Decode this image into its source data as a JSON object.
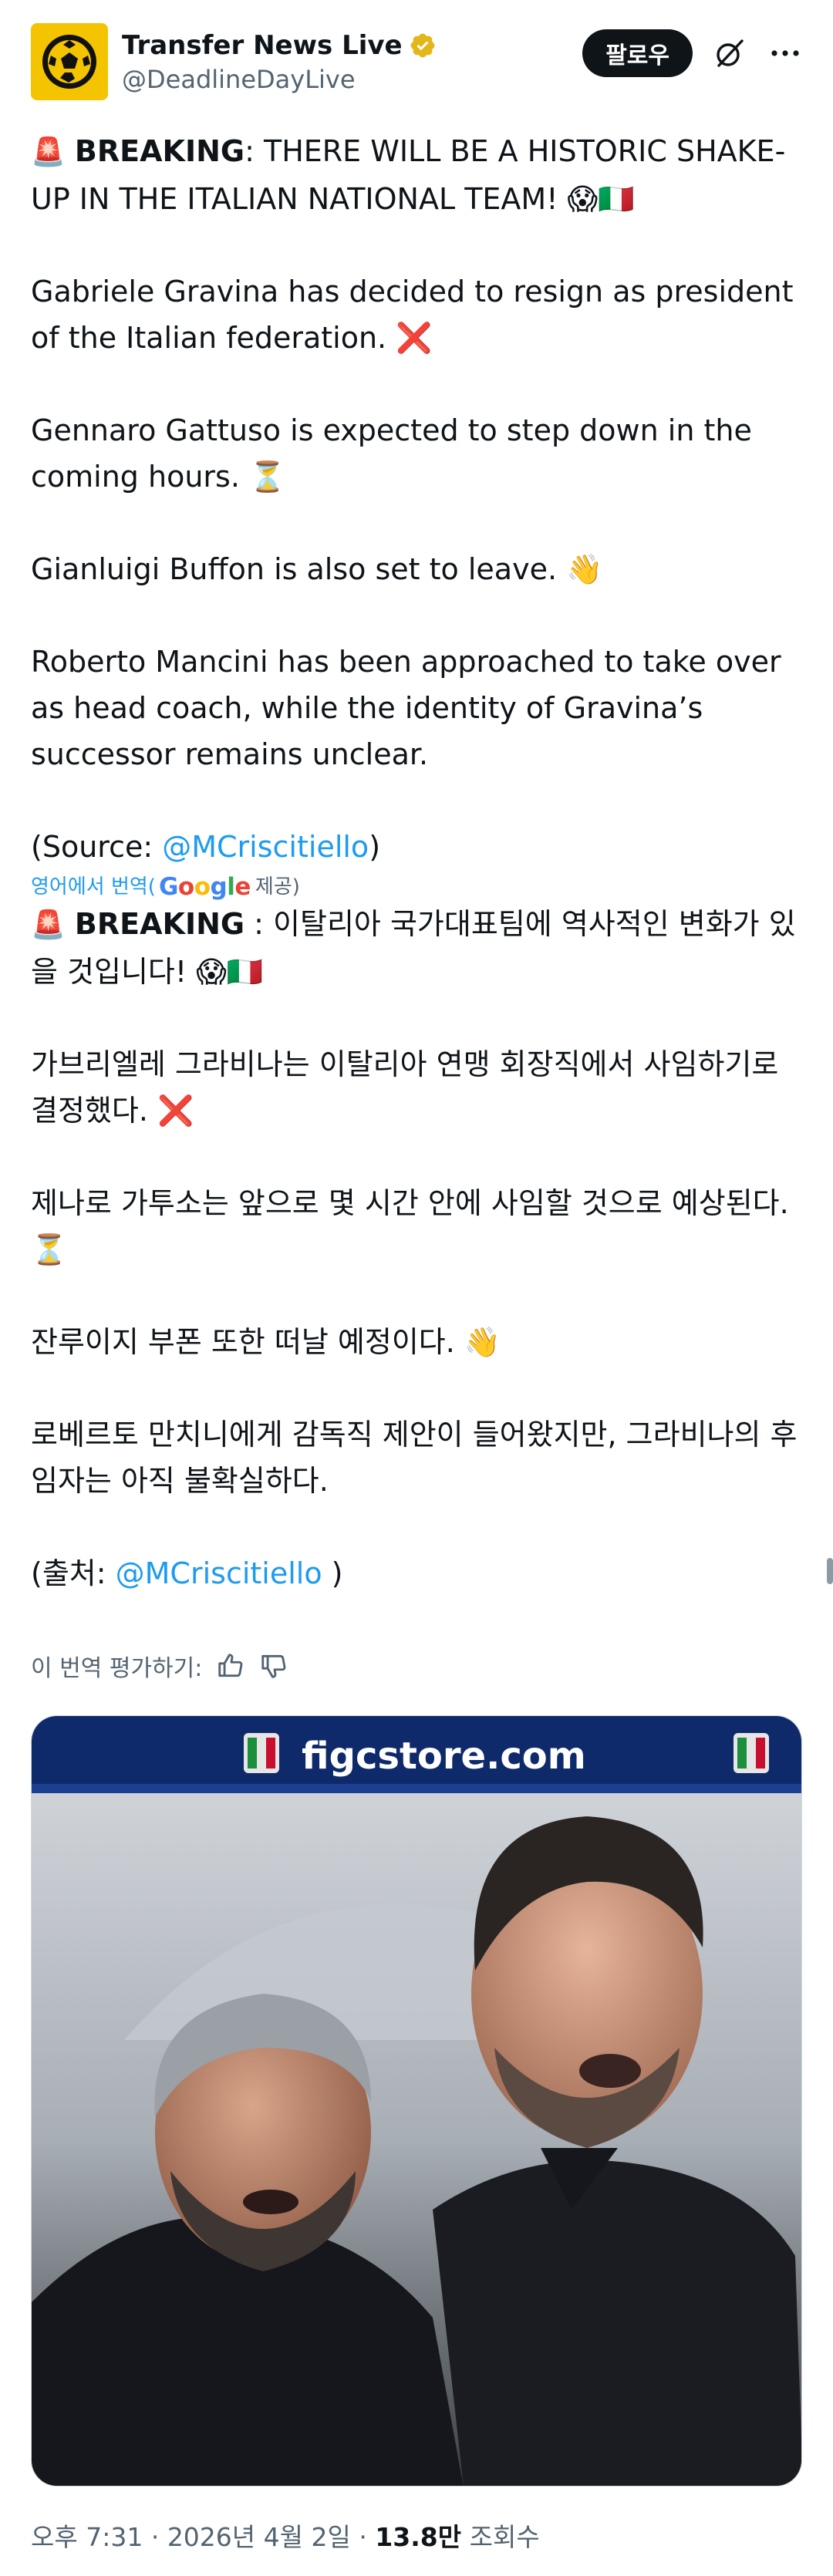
{
  "author": {
    "display_name": "Transfer News Live",
    "handle": "@DeadlineDayLive",
    "verified": true,
    "avatar_icon": "soccer-ball-icon",
    "avatar_color": "#f5c400"
  },
  "actions": {
    "follow_label": "팔로우",
    "grok_icon": "grok-icon",
    "more_icon": "more-icon"
  },
  "original": {
    "p1_lead": "BREAKING",
    "p1_rest": ": THERE WILL BE A HISTORIC SHAKE-UP IN THE ITALIAN NATIONAL TEAM! 😱🇮🇹",
    "p2": "Gabriele Gravina has decided to resign as president of the Italian federation. ❌",
    "p3": "Gennaro Gattuso is expected to step down in the coming hours. ⏳",
    "p4": "Gianluigi Buffon is also set to leave. 👋",
    "p5": "Roberto Mancini has been approached to take over as head coach, while the identity of Gravina’s successor remains unclear.",
    "source_prefix": "(Source: ",
    "source_mention": "@MCriscitiello",
    "source_suffix": ")"
  },
  "translation_bar": {
    "link": "영어에서 번역",
    "open": "(",
    "google": "Google",
    "provided": " 제공)"
  },
  "translated": {
    "p1_lead": "BREAKING",
    "p1_rest": " : 이탈리아 국가대표팀에 역사적인 변화가 있을 것입니다! 😱🇮🇹",
    "p2": "가브리엘레 그라비나는 이탈리아 연맹 회장직에서 사임하기로 결정했다. ❌",
    "p3": "제나로 가투소는 앞으로 몇 시간 안에 사임할 것으로 예상된다. ⏳",
    "p4": "잔루이지 부폰 또한 떠날 예정이다. 👋",
    "p5": "로베르토 만치니에게 감독직 제안이 들어왔지만, 그라비나의 후임자는 아직 불확실하다.",
    "source_prefix": "(출처: ",
    "source_mention": "@MCriscitiello",
    "source_suffix": " )"
  },
  "rate_translation": {
    "label": "이 번역 평가하기:",
    "up_icon": "thumbs-up-icon",
    "down_icon": "thumbs-down-icon"
  },
  "media": {
    "banner_text": "figcstore.com",
    "alt": "photo"
  },
  "meta": {
    "time": "오후 7:31",
    "sep1": " · ",
    "date": "2026년 4월 2일",
    "sep2": " · ",
    "views_count": "13.8만",
    "views_label": " 조회수"
  },
  "colors": {
    "link": "#1d9bf0",
    "text": "#0f1419",
    "secondary": "#536471",
    "siren": "#e0245e"
  }
}
